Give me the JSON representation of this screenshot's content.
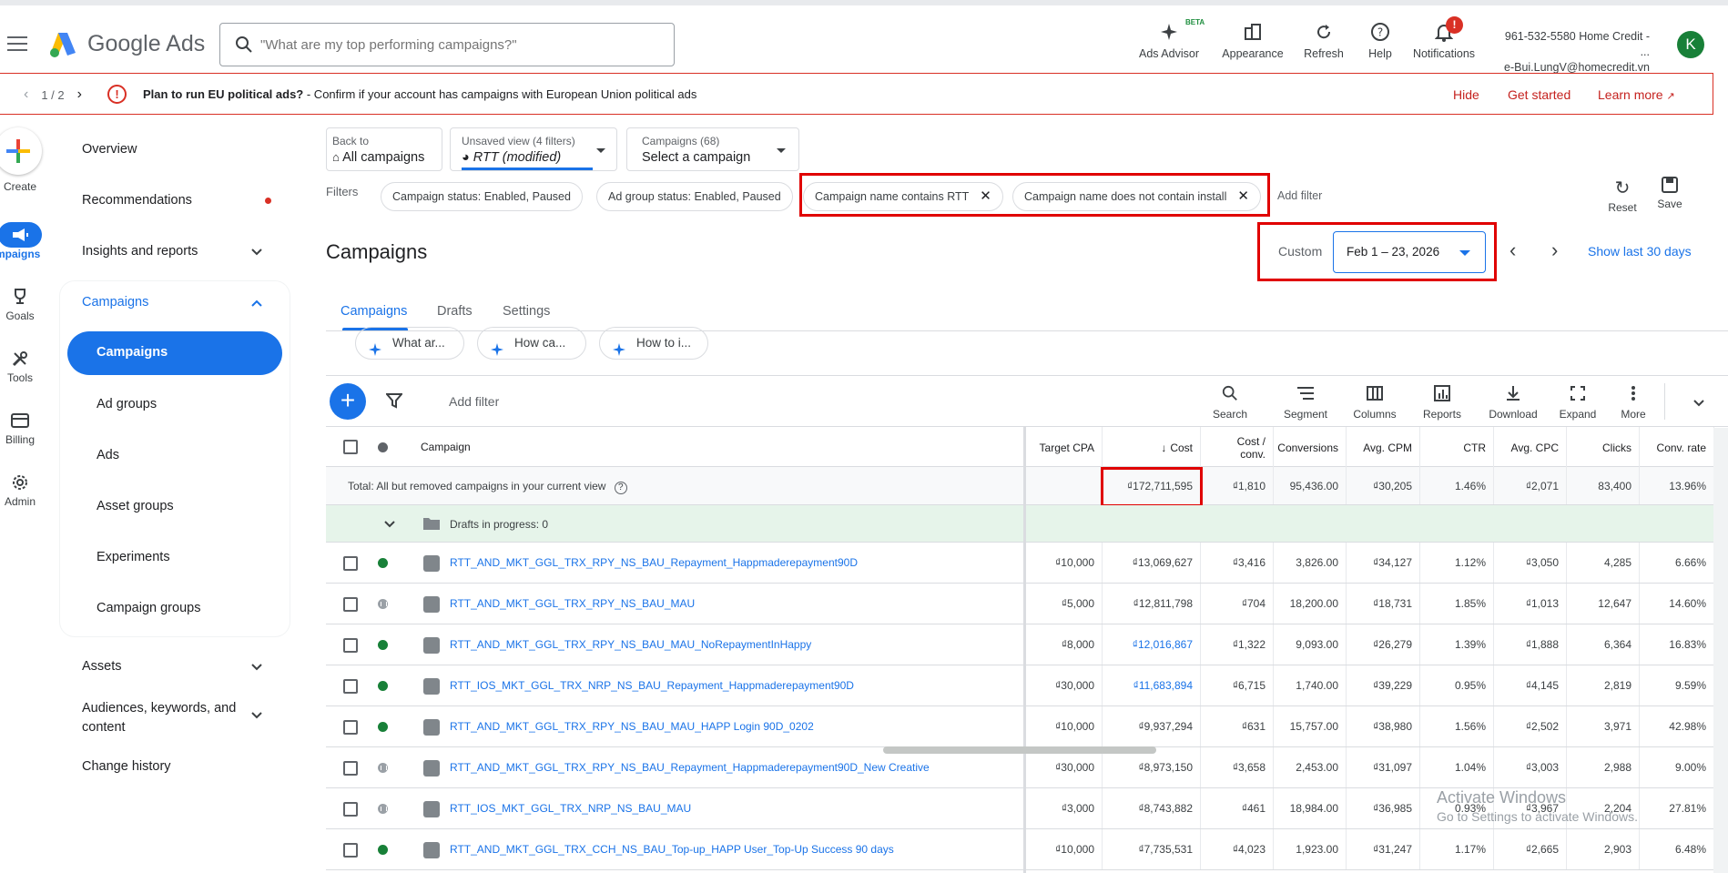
{
  "app": {
    "name": "Google Ads"
  },
  "search": {
    "placeholder": "\"What are my top performing campaigns?\""
  },
  "topbar": {
    "ads_advisor": "Ads Advisor",
    "beta": "BETA",
    "appearance": "Appearance",
    "refresh": "Refresh",
    "help": "Help",
    "notifications": "Notifications",
    "notif_count": "!",
    "account_line1": "961-532-5580 Home Credit - ...",
    "account_line2": "e-Bui.LungV@homecredit.vn",
    "avatar_letter": "K"
  },
  "banner": {
    "pager": "1 / 2",
    "title": "Plan to run EU political ads?",
    "text": " - Confirm if your account has campaigns with European Union political ads",
    "hide": "Hide",
    "get_started": "Get started",
    "learn_more": "Learn more"
  },
  "rail": {
    "create": "Create",
    "campaigns": "Campaigns",
    "goals": "Goals",
    "tools": "Tools",
    "billing": "Billing",
    "admin": "Admin"
  },
  "nav": {
    "overview": "Overview",
    "recommendations": "Recommendations",
    "insights": "Insights and reports",
    "campaigns_group": "Campaigns",
    "campaigns": "Campaigns",
    "ad_groups": "Ad groups",
    "ads": "Ads",
    "asset_groups": "Asset groups",
    "experiments": "Experiments",
    "campaign_groups": "Campaign groups",
    "assets": "Assets",
    "audiences": "Audiences, keywords, and content",
    "change_history": "Change history"
  },
  "controls": {
    "back_small": "Back to",
    "back_big": "All campaigns",
    "view_small": "Unsaved view (4 filters)",
    "view_big": "RTT (modified)",
    "camp_small": "Campaigns (68)",
    "camp_big": "Select a campaign"
  },
  "filters": {
    "label": "Filters",
    "chips": [
      "Campaign status: Enabled, Paused",
      "Ad group status: Enabled, Paused",
      "Campaign name contains RTT",
      "Campaign name does not contain install"
    ],
    "add": "Add filter",
    "reset": "Reset",
    "save": "Save"
  },
  "page": {
    "title": "Campaigns",
    "custom": "Custom",
    "date_range": "Feb 1 – 23, 2026",
    "show_last": "Show last 30 days"
  },
  "tabs": [
    "Campaigns",
    "Drafts",
    "Settings"
  ],
  "suggestions": [
    "What ar...",
    "How ca...",
    "How to i..."
  ],
  "toolbar": {
    "add_filter": "Add filter",
    "search": "Search",
    "segment": "Segment",
    "columns": "Columns",
    "reports": "Reports",
    "download": "Download",
    "expand": "Expand",
    "more": "More"
  },
  "table": {
    "headers": {
      "campaign": "Campaign",
      "target_cpa": "Target CPA",
      "cost": "Cost",
      "cost_conv": "Cost / conv.",
      "conversions": "Conversions",
      "avg_cpm": "Avg. CPM",
      "ctr": "CTR",
      "avg_cpc": "Avg. CPC",
      "clicks": "Clicks",
      "conv_rate": "Conv. rate"
    },
    "total": {
      "label": "Total: All but removed campaigns in your current view",
      "cost": "₫172,711,595",
      "cost_conv": "₫1,810",
      "conversions": "95,436.00",
      "avg_cpm": "₫30,205",
      "ctr": "1.46%",
      "avg_cpc": "₫2,071",
      "clicks": "83,400",
      "conv_rate": "13.96%"
    },
    "drafts": "Drafts in progress: 0",
    "rows": [
      {
        "status": "enabled",
        "name": "RTT_AND_MKT_GGL_TRX_RPY_NS_BAU_Repayment_Happmaderepayment90D",
        "target_cpa": "₫10,000",
        "cost": "₫13,069,627",
        "cost_conv": "₫3,416",
        "conversions": "3,826.00",
        "avg_cpm": "₫34,127",
        "ctr": "1.12%",
        "avg_cpc": "₫3,050",
        "clicks": "4,285",
        "conv_rate": "6.66%"
      },
      {
        "status": "paused",
        "name": "RTT_AND_MKT_GGL_TRX_RPY_NS_BAU_MAU",
        "target_cpa": "₫5,000",
        "cost": "₫12,811,798",
        "cost_conv": "₫704",
        "conversions": "18,200.00",
        "avg_cpm": "₫18,731",
        "ctr": "1.85%",
        "avg_cpc": "₫1,013",
        "clicks": "12,647",
        "conv_rate": "14.60%"
      },
      {
        "status": "enabled",
        "name": "RTT_AND_MKT_GGL_TRX_RPY_NS_BAU_MAU_NoRepaymentInHappy",
        "target_cpa": "₫8,000",
        "cost": "₫12,016,867",
        "cost_conv": "₫1,322",
        "conversions": "9,093.00",
        "avg_cpm": "₫26,279",
        "ctr": "1.39%",
        "avg_cpc": "₫1,888",
        "clicks": "6,364",
        "conv_rate": "16.83%"
      },
      {
        "status": "enabled",
        "name": "RTT_IOS_MKT_GGL_TRX_NRP_NS_BAU_Repayment_Happmaderepayment90D",
        "target_cpa": "₫30,000",
        "cost": "₫11,683,894",
        "cost_conv": "₫6,715",
        "conversions": "1,740.00",
        "avg_cpm": "₫39,229",
        "ctr": "0.95%",
        "avg_cpc": "₫4,145",
        "clicks": "2,819",
        "conv_rate": "9.59%"
      },
      {
        "status": "enabled",
        "name": "RTT_AND_MKT_GGL_TRX_RPY_NS_BAU_MAU_HAPP Login 90D_0202",
        "target_cpa": "₫10,000",
        "cost": "₫9,937,294",
        "cost_conv": "₫631",
        "conversions": "15,757.00",
        "avg_cpm": "₫38,980",
        "ctr": "1.56%",
        "avg_cpc": "₫2,502",
        "clicks": "3,971",
        "conv_rate": "42.98%"
      },
      {
        "status": "paused",
        "name": "RTT_AND_MKT_GGL_TRX_RPY_NS_BAU_Repayment_Happmaderepayment90D_New Creative",
        "target_cpa": "₫30,000",
        "cost": "₫8,973,150",
        "cost_conv": "₫3,658",
        "conversions": "2,453.00",
        "avg_cpm": "₫31,097",
        "ctr": "1.04%",
        "avg_cpc": "₫3,003",
        "clicks": "2,988",
        "conv_rate": "9.00%"
      },
      {
        "status": "paused",
        "name": "RTT_IOS_MKT_GGL_TRX_NRP_NS_BAU_MAU",
        "target_cpa": "₫3,000",
        "cost": "₫8,743,882",
        "cost_conv": "₫461",
        "conversions": "18,984.00",
        "avg_cpm": "₫36,985",
        "ctr": "0.93%",
        "avg_cpc": "₫3,967",
        "clicks": "2,204",
        "conv_rate": "27.81%"
      },
      {
        "status": "enabled",
        "name": "RTT_AND_MKT_GGL_TRX_CCH_NS_BAU_Top-up_HAPP User_Top-Up Success 90 days",
        "target_cpa": "₫10,000",
        "cost": "₫7,735,531",
        "cost_conv": "₫4,023",
        "conversions": "1,923.00",
        "avg_cpm": "₫31,247",
        "ctr": "1.17%",
        "avg_cpc": "₫2,665",
        "clicks": "2,903",
        "conv_rate": "6.48%"
      }
    ]
  },
  "watermark": {
    "line1": "Activate Windows",
    "line2": "Go to Settings to activate Windows."
  }
}
